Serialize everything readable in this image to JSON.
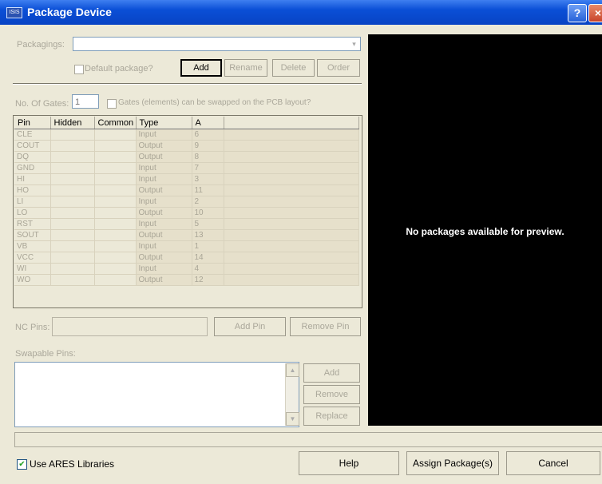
{
  "window": {
    "title": "Package Device",
    "app_icon": "ISIS",
    "help_glyph": "?",
    "close_glyph": "×"
  },
  "packagings": {
    "label": "Packagings:",
    "value": "",
    "dropdown_glyph": "▾",
    "default_label": "Default package?",
    "buttons": [
      "Add",
      "Rename",
      "Delete",
      "Order"
    ]
  },
  "gates": {
    "label": "No. Of Gates:",
    "value": "1",
    "swap_label": "Gates (elements) can be swapped on the PCB layout?"
  },
  "pin_table": {
    "columns": [
      "Pin",
      "Hidden",
      "Common",
      "Type",
      "A"
    ],
    "rows": [
      [
        "CLE",
        "",
        "",
        "Input",
        "6"
      ],
      [
        "COUT",
        "",
        "",
        "Output",
        "9"
      ],
      [
        "DQ",
        "",
        "",
        "Output",
        "8"
      ],
      [
        "GND",
        "",
        "",
        "Input",
        "7"
      ],
      [
        "HI",
        "",
        "",
        "Input",
        "3"
      ],
      [
        "HO",
        "",
        "",
        "Output",
        "11"
      ],
      [
        "LI",
        "",
        "",
        "Input",
        "2"
      ],
      [
        "LO",
        "",
        "",
        "Output",
        "10"
      ],
      [
        "RST",
        "",
        "",
        "Input",
        "5"
      ],
      [
        "SOUT",
        "",
        "",
        "Output",
        "13"
      ],
      [
        "VB",
        "",
        "",
        "Input",
        "1"
      ],
      [
        "VCC",
        "",
        "",
        "Output",
        "14"
      ],
      [
        "WI",
        "",
        "",
        "Input",
        "4"
      ],
      [
        "WO",
        "",
        "",
        "Output",
        "12"
      ]
    ]
  },
  "nc_pins": {
    "label": "NC Pins:",
    "value": "",
    "add": "Add Pin",
    "remove": "Remove Pin"
  },
  "swappable": {
    "label": "Swapable Pins:",
    "buttons": [
      "Add",
      "Remove",
      "Replace"
    ]
  },
  "preview": {
    "message": "No packages available for preview."
  },
  "footer": {
    "use_libraries": "Use ARES Libraries",
    "use_libraries_checked": true,
    "help": "Help",
    "assign": "Assign Package(s)",
    "cancel": "Cancel"
  }
}
